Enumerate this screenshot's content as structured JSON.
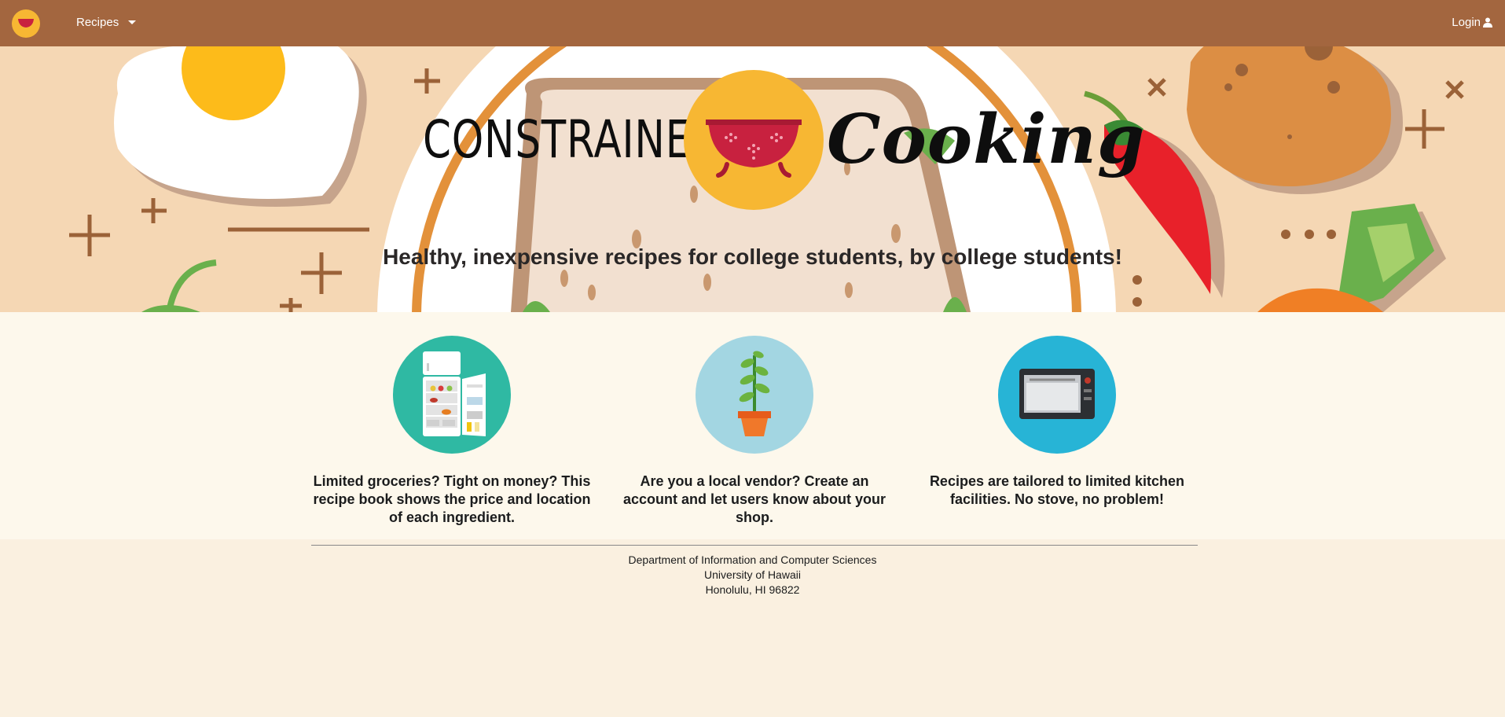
{
  "nav": {
    "logo_icon": "colander-icon",
    "recipes_label": "Recipes",
    "login_label": "Login",
    "login_icon": "user-icon"
  },
  "hero": {
    "title_left": "CONSTRAINED",
    "title_right": "Cooking",
    "title_icon": "colander-icon",
    "tagline": "Healthy, inexpensive recipes for college students, by college students!"
  },
  "features": [
    {
      "icon": "fridge-icon",
      "text": "Limited groceries? Tight on money? This recipe book shows the price and location of each ingredient."
    },
    {
      "icon": "plant-icon",
      "text": "Are you a local vendor? Create an account and let users know about your shop."
    },
    {
      "icon": "oven-icon",
      "text": "Recipes are tailored to limited kitchen facilities. No stove, no problem!"
    }
  ],
  "footer": {
    "line1": "Department of Information and Computer Sciences",
    "line2": "University of Hawaii",
    "line3": "Honolulu, HI 96822"
  },
  "colors": {
    "navbar": "#a3663f",
    "hero_bg": "#f5d7b4",
    "accent_yellow": "#f7b733",
    "colander_red": "#c8213f"
  }
}
